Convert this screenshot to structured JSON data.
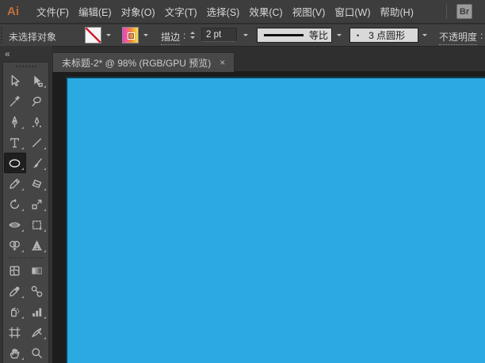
{
  "menu_bar": {
    "app_icon_label": "Ai",
    "items": [
      "文件(F)",
      "编辑(E)",
      "对象(O)",
      "文字(T)",
      "选择(S)",
      "效果(C)",
      "视图(V)",
      "窗口(W)",
      "帮助(H)"
    ],
    "bridge_icon_label": "Br"
  },
  "control_bar": {
    "selection_status": "未选择对象",
    "stroke": {
      "label": "描边",
      "colon": ":",
      "value": "2 pt"
    },
    "variable_width_profile": {
      "value": "等比"
    },
    "brush_definition": {
      "bullet": "•",
      "value": "3 点圆形"
    },
    "opacity": {
      "label": "不透明度",
      "colon": ":"
    }
  },
  "tab_bar": {
    "active_tab": {
      "title": "未标题-2* @ 98% (RGB/GPU 预览)",
      "close_glyph": "×"
    }
  },
  "tool_panel": {
    "collapse_glyph": "«",
    "selected_tool": "ellipse",
    "tools": [
      "selection",
      "direct-selection",
      "magic-wand",
      "lasso",
      "pen",
      "curvature",
      "type",
      "line-segment",
      "ellipse",
      "paintbrush",
      "pencil",
      "eraser",
      "rotate",
      "scale",
      "width",
      "free-transform",
      "shape-builder",
      "perspective-grid",
      "mesh",
      "gradient",
      "eyedropper",
      "blend",
      "symbol-sprayer",
      "column-graph",
      "artboard",
      "slice",
      "hand",
      "zoom"
    ]
  },
  "canvas": {
    "color": "#2BA9E1"
  },
  "colors": {
    "canvas_blue": "#2BA9E1",
    "ui_dark_gray": "#3e3e3e",
    "pasteboard": "#1d1d1d",
    "app_icon_orange": "#c2703d",
    "swatch_none_red": "#cf2030",
    "swatch_gradient_start": "#ee3ecf",
    "swatch_gradient_end": "#f5e04e"
  }
}
